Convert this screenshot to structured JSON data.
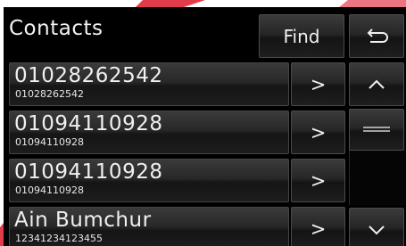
{
  "header": {
    "title": "Contacts",
    "find_label": "Find"
  },
  "contacts": [
    {
      "name": "01028262542",
      "number": "01028262542"
    },
    {
      "name": "01094110928",
      "number": "01094110928"
    },
    {
      "name": "01094110928",
      "number": "01094110928"
    },
    {
      "name": "Ain Bumchur",
      "number": "12341234123455"
    }
  ],
  "row_arrow_label": ">",
  "icons": {
    "back": "back-arrow-icon",
    "scroll_up": "chevron-up-icon",
    "scroll_down": "chevron-down-icon",
    "scroll_thumb": "grip-lines-icon"
  },
  "colors": {
    "background": "#000000",
    "text": "#f0f0f0",
    "accent_stripe": "#e03a4a"
  }
}
